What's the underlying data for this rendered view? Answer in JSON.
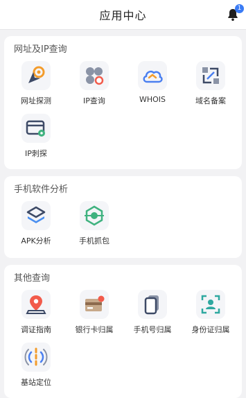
{
  "header": {
    "title": "应用中心",
    "notification_count": "1"
  },
  "sections": [
    {
      "title": "网址及IP查询",
      "apps": [
        {
          "label": "网址探测"
        },
        {
          "label": "IP查询"
        },
        {
          "label": "WHOIS"
        },
        {
          "label": "域名备案"
        },
        {
          "label": "IP刺探"
        }
      ]
    },
    {
      "title": "手机软件分析",
      "apps": [
        {
          "label": "APK分析"
        },
        {
          "label": "手机抓包"
        }
      ]
    },
    {
      "title": "其他查询",
      "apps": [
        {
          "label": "调证指南"
        },
        {
          "label": "银行卡归属"
        },
        {
          "label": "手机号归属"
        },
        {
          "label": "身份证归属"
        },
        {
          "label": "基站定位"
        }
      ]
    }
  ],
  "colors": {
    "accent_blue": "#3a7bf5",
    "accent_orange": "#f39c2b",
    "accent_green": "#3fb27f",
    "accent_red": "#f25b4b",
    "icon_gray": "#8a93a6"
  }
}
